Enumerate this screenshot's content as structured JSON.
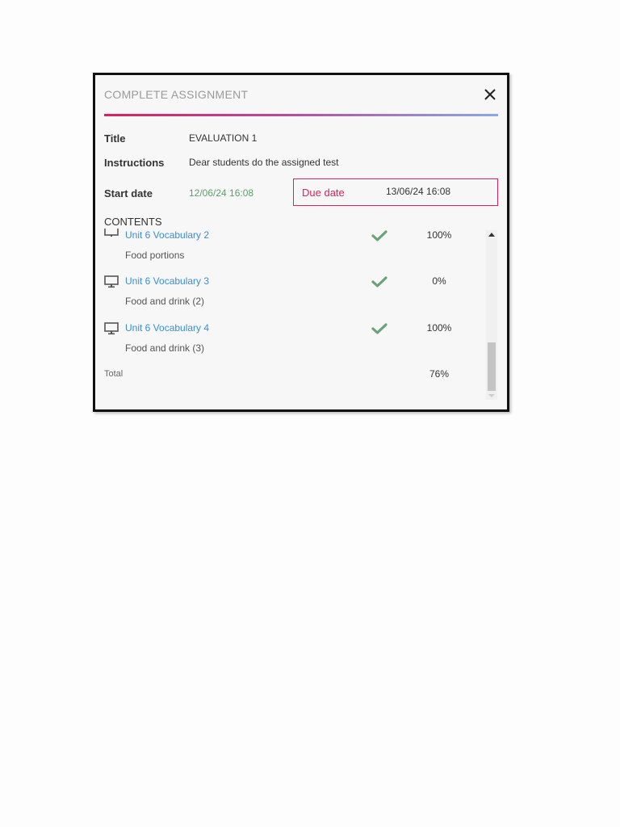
{
  "dialog": {
    "title": "COMPLETE ASSIGNMENT",
    "close_icon": "close-icon"
  },
  "fields": {
    "title_label": "Title",
    "title_value": "EVALUATION 1",
    "instructions_label": "Instructions",
    "instructions_value": "Dear students do the assigned test",
    "start_label": "Start date",
    "start_value": "12/06/24 16:08",
    "due_label": "Due date",
    "due_value": "13/06/24 16:08"
  },
  "contents": {
    "heading": "CONTENTS",
    "items": [
      {
        "title": "Unit 6 Vocabulary 2",
        "subtitle": "Food portions",
        "percent": "100%",
        "icon": "monitor-icon",
        "status_icon": "check-icon"
      },
      {
        "title": "Unit 6 Vocabulary 3",
        "subtitle": "Food and drink (2)",
        "percent": "0%",
        "icon": "monitor-icon",
        "status_icon": "check-icon"
      },
      {
        "title": "Unit 6 Vocabulary 4",
        "subtitle": "Food and drink (3)",
        "percent": "100%",
        "icon": "monitor-icon",
        "status_icon": "check-icon"
      }
    ],
    "total_label": "Total",
    "total_value": "76%"
  },
  "colors": {
    "accent_red": "#d6245a",
    "link_blue": "#3a8ed1",
    "success_green": "#5f9e6e",
    "gradient_end": "#8aa8e8"
  }
}
